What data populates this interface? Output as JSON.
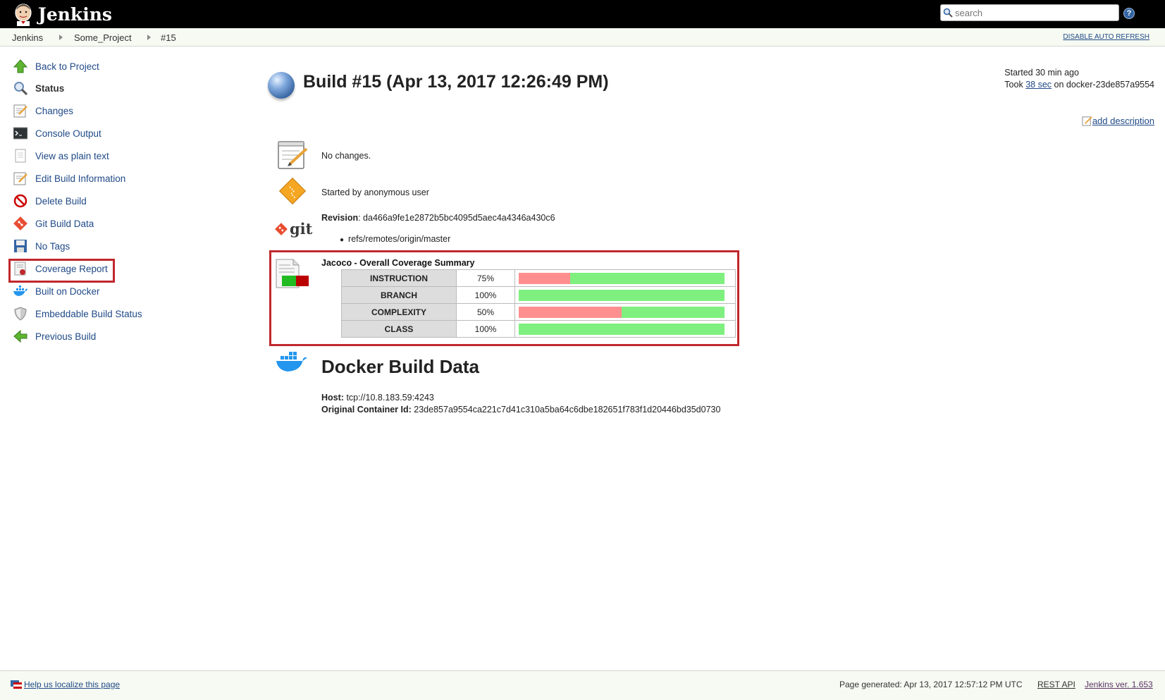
{
  "header": {
    "title": "Jenkins",
    "search_placeholder": "search",
    "help_label": "?"
  },
  "breadcrumbs": [
    "Jenkins",
    "Some_Project",
    "#15"
  ],
  "disable_auto_refresh": "DISABLE AUTO REFRESH",
  "sidebar": {
    "items": [
      {
        "label": "Back to Project",
        "icon": "up-arrow-icon"
      },
      {
        "label": "Status",
        "icon": "search-icon"
      },
      {
        "label": "Changes",
        "icon": "notepad-icon"
      },
      {
        "label": "Console Output",
        "icon": "terminal-icon"
      },
      {
        "label": "View as plain text",
        "icon": "document-icon"
      },
      {
        "label": "Edit Build Information",
        "icon": "notepad-icon"
      },
      {
        "label": "Delete Build",
        "icon": "no-entry-icon"
      },
      {
        "label": "Git Build Data",
        "icon": "git-icon"
      },
      {
        "label": "No Tags",
        "icon": "save-icon"
      },
      {
        "label": "Coverage Report",
        "icon": "report-icon"
      },
      {
        "label": "Built on Docker",
        "icon": "docker-icon"
      },
      {
        "label": "Embeddable Build Status",
        "icon": "shield-icon"
      },
      {
        "label": "Previous Build",
        "icon": "left-arrow-icon"
      }
    ]
  },
  "build": {
    "title": "Build #15 (Apr 13, 2017 12:26:49 PM)",
    "started": "Started 30 min ago",
    "took_prefix": "Took",
    "took_link": "38 sec",
    "took_suffix": "on docker-23de857a9554",
    "add_description": "add description",
    "changes": "No changes.",
    "started_by": "Started by anonymous user",
    "revision_label": "Revision",
    "revision_value": ": da466a9fe1e2872b5bc4095d5aec4a4346a430c6",
    "git_label": "git",
    "branch": "refs/remotes/origin/master"
  },
  "coverage": {
    "title": "Jacoco - Overall Coverage Summary",
    "rows": [
      {
        "name": "INSTRUCTION",
        "pct": "75%",
        "covered": 0.75
      },
      {
        "name": "BRANCH",
        "pct": "100%",
        "covered": 1.0
      },
      {
        "name": "COMPLEXITY",
        "pct": "50%",
        "covered": 0.5
      },
      {
        "name": "CLASS",
        "pct": "100%",
        "covered": 1.0
      }
    ],
    "colors": {
      "missed": "#ff8f8f",
      "covered": "#7ff07f"
    }
  },
  "docker": {
    "title": "Docker Build Data",
    "host_label": "Host:",
    "host_value": "tcp://10.8.183.59:4243",
    "container_label": "Original Container Id:",
    "container_value": "23de857a9554ca221c7d41c310a5ba64c6dbe182651f783f1d20446bd35d0730"
  },
  "footer": {
    "localize": "Help us localize this page",
    "generated": "Page generated: Apr 13, 2017 12:57:12 PM UTC",
    "rest_api": "REST API",
    "version": "Jenkins ver. 1.653"
  }
}
